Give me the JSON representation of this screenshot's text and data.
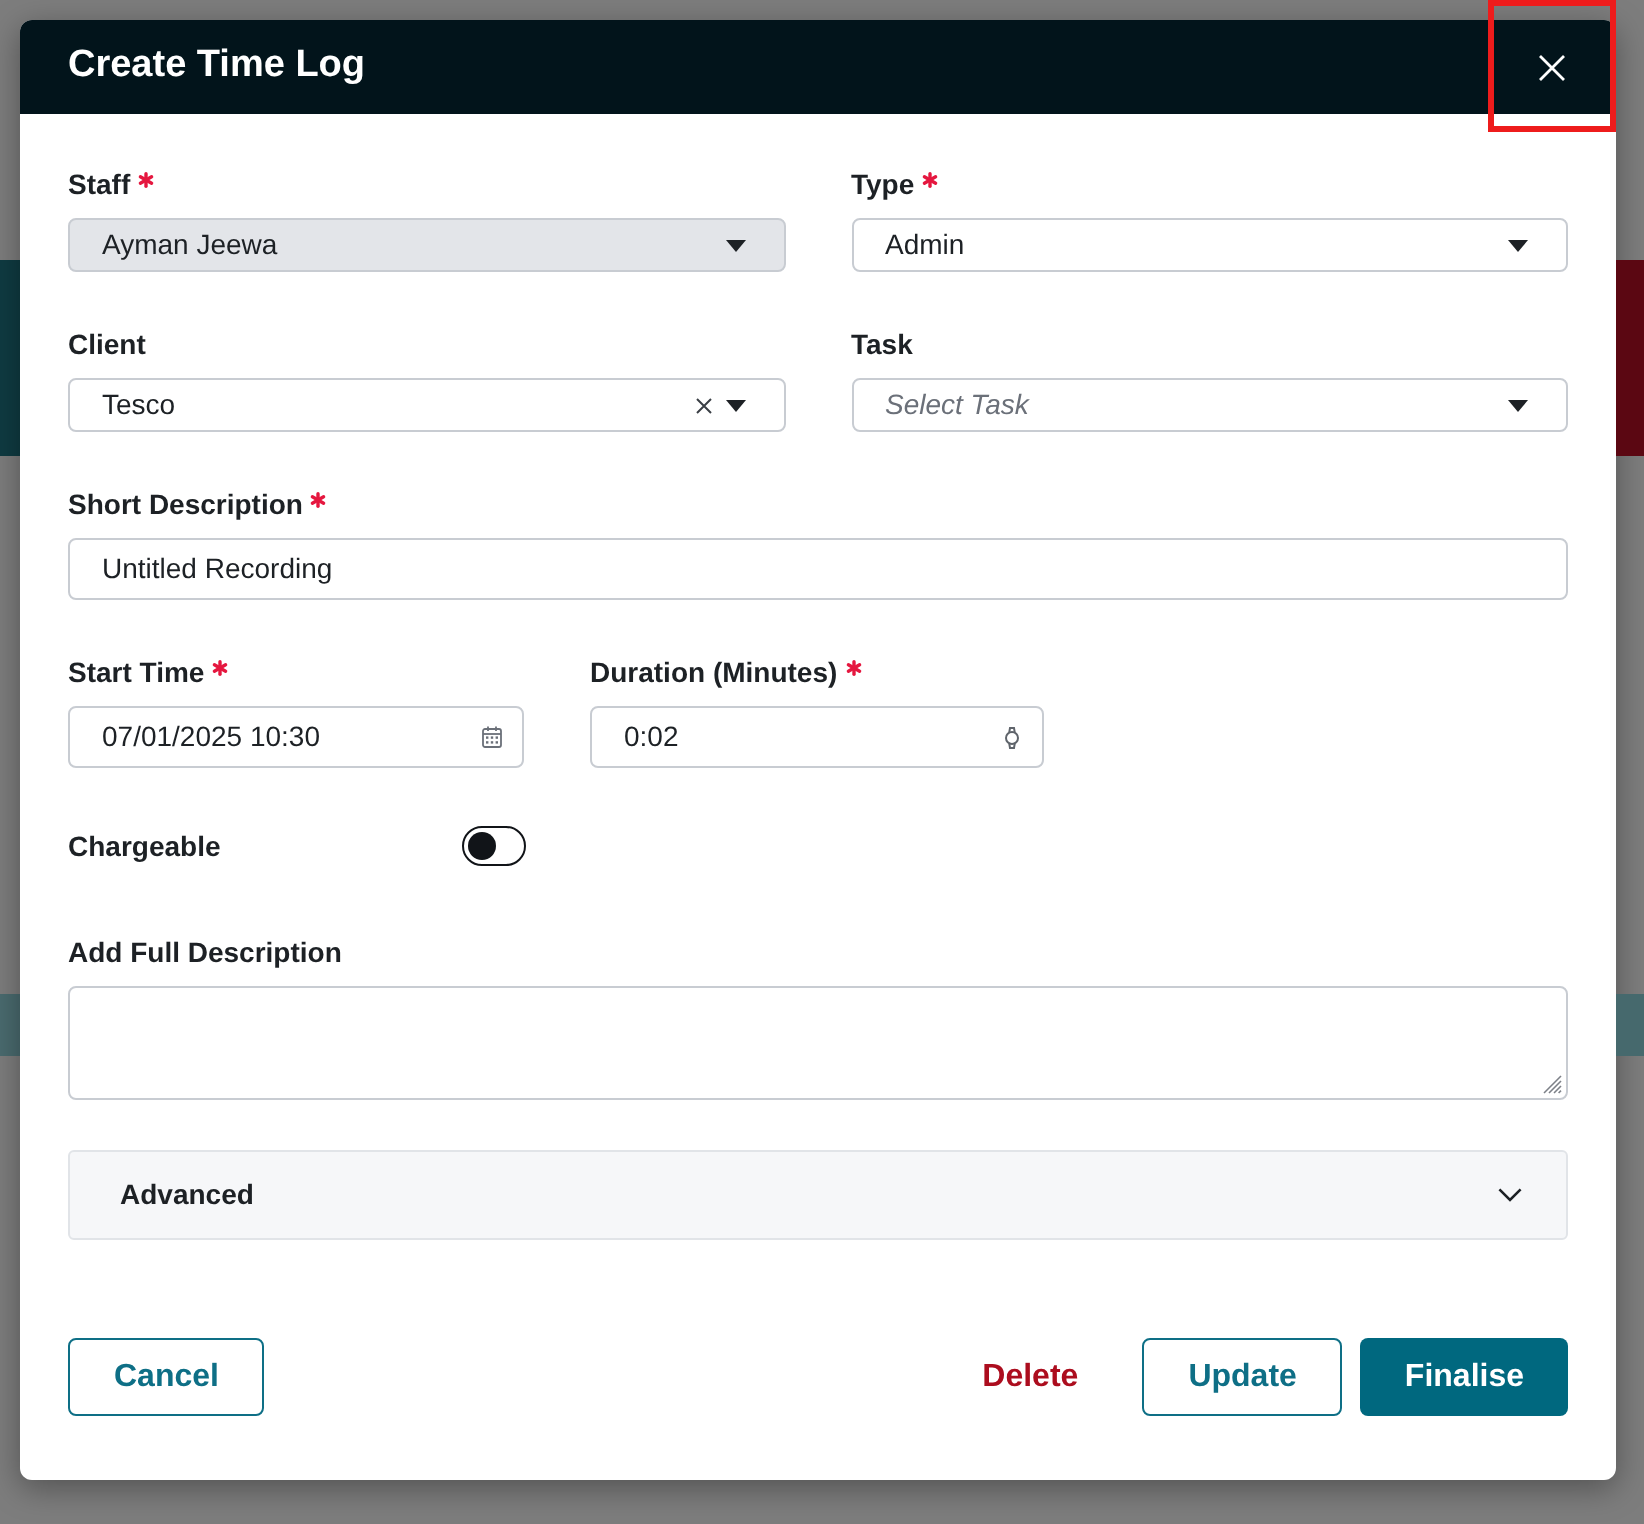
{
  "dialog": {
    "title": "Create Time Log",
    "close_button": {
      "highlighted": true
    }
  },
  "rows": [
    {
      "fields": [
        {
          "kind": "select",
          "label": "Staff",
          "required": true,
          "value": "Ayman Jeewa",
          "disabled": true,
          "clearable": false
        },
        {
          "kind": "select",
          "label": "Type",
          "required": true,
          "value": "Admin",
          "disabled": false,
          "clearable": false
        }
      ]
    },
    {
      "fields": [
        {
          "kind": "select",
          "label": "Client",
          "required": false,
          "value": "Tesco",
          "disabled": false,
          "clearable": true
        },
        {
          "kind": "select",
          "label": "Task",
          "required": false,
          "placeholder": "Select Task",
          "disabled": false,
          "clearable": false
        }
      ]
    },
    {
      "fields": [
        {
          "kind": "text",
          "label": "Short Description",
          "required": true,
          "value": "Untitled Recording"
        }
      ]
    },
    {
      "fields": [
        {
          "kind": "datetime",
          "label": "Start Time",
          "required": true,
          "value": "07/01/2025 10:30"
        },
        {
          "kind": "duration",
          "label": "Duration (Minutes)",
          "required": true,
          "value": "0:02"
        }
      ]
    },
    {
      "fields": [
        {
          "kind": "toggle",
          "label": "Chargeable",
          "on": false
        }
      ]
    },
    {
      "fields": [
        {
          "kind": "textarea",
          "label": "Add Full Description",
          "required": false
        }
      ]
    }
  ],
  "advanced": {
    "label": "Advanced",
    "expanded": false
  },
  "buttons": [
    {
      "label": "Cancel",
      "kind": "outline"
    },
    {
      "label": "Delete",
      "kind": "danger"
    },
    {
      "label": "Update",
      "kind": "outline"
    },
    {
      "label": "Finalise",
      "kind": "primary"
    }
  ]
}
